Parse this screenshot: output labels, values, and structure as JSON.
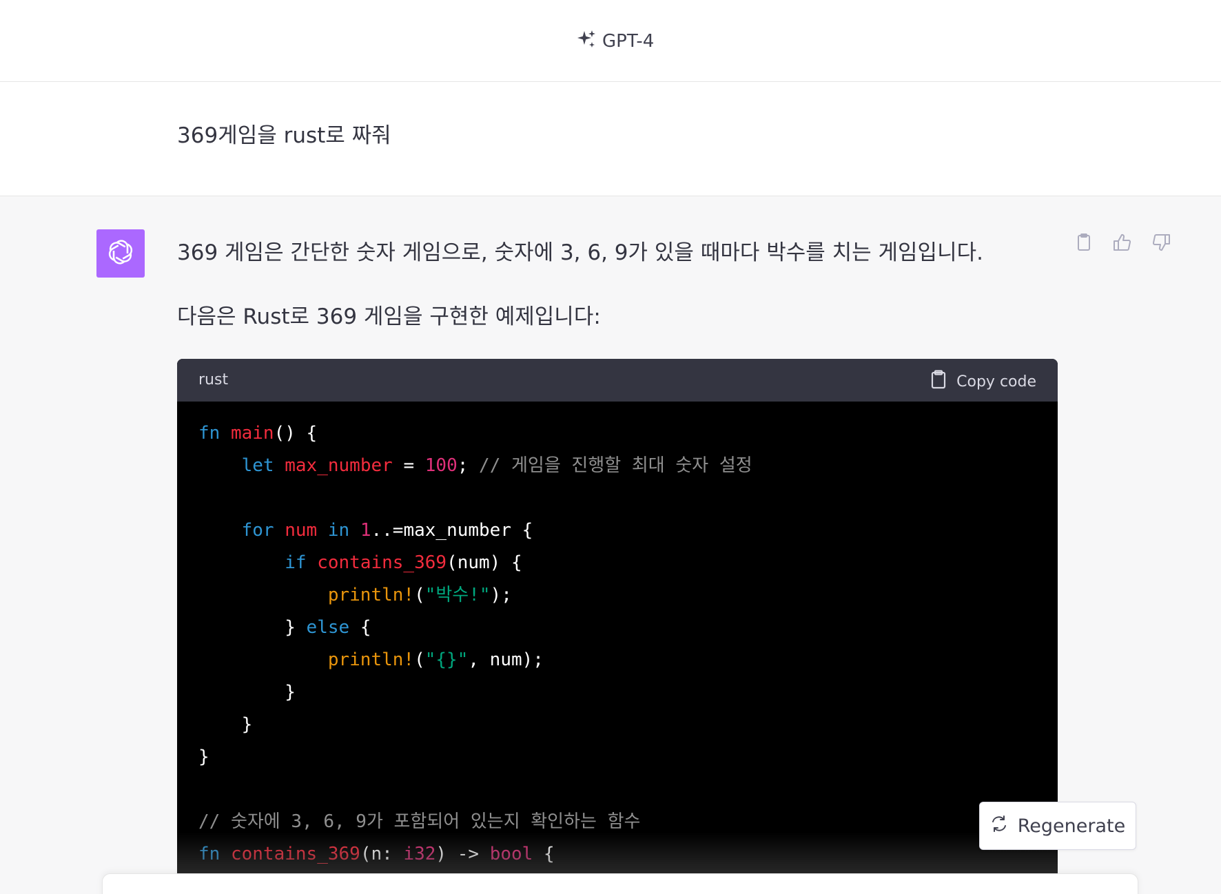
{
  "header": {
    "model_icon": "sparkle-icon",
    "model_name": "GPT-4"
  },
  "user_message": {
    "text": "369게임을 rust로 짜줘"
  },
  "assistant_message": {
    "avatar_icon": "openai-logo-icon",
    "paragraph_1": "369 게임은 간단한 숫자 게임으로, 숫자에 3, 6, 9가 있을 때마다 박수를 치는 게임입니다.",
    "paragraph_2": "다음은 Rust로 369 게임을 구현한 예제입니다:",
    "actions": [
      {
        "icon": "clipboard-icon"
      },
      {
        "icon": "thumbs-up-icon"
      },
      {
        "icon": "thumbs-down-icon"
      }
    ]
  },
  "code_block": {
    "language": "rust",
    "copy_label": "Copy code",
    "copy_icon": "clipboard-icon",
    "lines": [
      [
        [
          "kw",
          "fn"
        ],
        [
          "p",
          " "
        ],
        [
          "fn",
          "main"
        ],
        [
          "p",
          "() {"
        ]
      ],
      [
        [
          "p",
          "    "
        ],
        [
          "kw",
          "let"
        ],
        [
          "p",
          " "
        ],
        [
          "fn",
          "max_number"
        ],
        [
          "p",
          " = "
        ],
        [
          "num",
          "100"
        ],
        [
          "p",
          "; "
        ],
        [
          "com",
          "// 게임을 진행할 최대 숫자 설정"
        ]
      ],
      [
        [
          "p",
          ""
        ]
      ],
      [
        [
          "p",
          "    "
        ],
        [
          "kw",
          "for"
        ],
        [
          "p",
          " "
        ],
        [
          "fn",
          "num"
        ],
        [
          "p",
          " "
        ],
        [
          "kw",
          "in"
        ],
        [
          "p",
          " "
        ],
        [
          "num",
          "1"
        ],
        [
          "p",
          "..=max_number {"
        ]
      ],
      [
        [
          "p",
          "        "
        ],
        [
          "kw",
          "if"
        ],
        [
          "p",
          " "
        ],
        [
          "fn",
          "contains_369"
        ],
        [
          "p",
          "(num) {"
        ]
      ],
      [
        [
          "p",
          "            "
        ],
        [
          "macro",
          "println!"
        ],
        [
          "p",
          "("
        ],
        [
          "str",
          "\"박수!\""
        ],
        [
          "p",
          ");"
        ]
      ],
      [
        [
          "p",
          "        } "
        ],
        [
          "kw",
          "else"
        ],
        [
          "p",
          " {"
        ]
      ],
      [
        [
          "p",
          "            "
        ],
        [
          "macro",
          "println!"
        ],
        [
          "p",
          "("
        ],
        [
          "str",
          "\"{}\""
        ],
        [
          "p",
          ", num);"
        ]
      ],
      [
        [
          "p",
          "        }"
        ]
      ],
      [
        [
          "p",
          "    }"
        ]
      ],
      [
        [
          "p",
          "}"
        ]
      ],
      [
        [
          "p",
          ""
        ]
      ],
      [
        [
          "com",
          "// 숫자에 3, 6, 9가 포함되어 있는지 확인하는 함수"
        ]
      ],
      [
        [
          "kw",
          "fn"
        ],
        [
          "p",
          " "
        ],
        [
          "fn",
          "contains_369"
        ],
        [
          "p",
          "(n: "
        ],
        [
          "type",
          "i32"
        ],
        [
          "p",
          ") -> "
        ],
        [
          "type",
          "bool"
        ],
        [
          "p",
          " {"
        ]
      ]
    ]
  },
  "regenerate": {
    "icon": "refresh-icon",
    "label": "Regenerate"
  },
  "colors": {
    "avatar_bg": "#ab68ff",
    "code_bg": "#000000",
    "code_header_bg": "#343541",
    "keyword": "#2e95d3",
    "function": "#f22c3d",
    "number": "#df3079",
    "macro": "#e9950c",
    "string": "#00a67d",
    "comment": "#8f8f8f"
  }
}
